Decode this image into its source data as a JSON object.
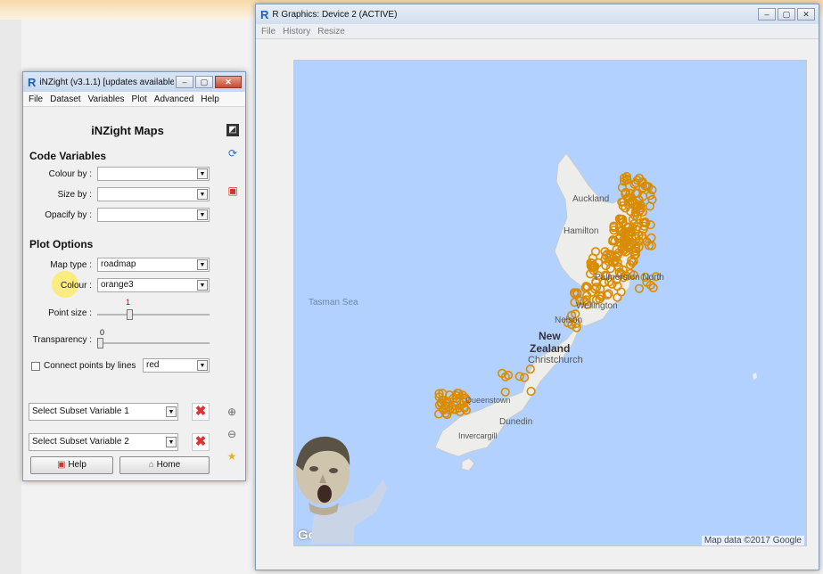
{
  "inzight": {
    "title": "iNZight (v3.1.1) [updates available]",
    "menu": [
      "File",
      "Dataset",
      "Variables",
      "Plot",
      "Advanced",
      "Help"
    ],
    "heading": "iNZight Maps",
    "code_variables": {
      "title": "Code Variables",
      "colour_by_label": "Colour by :",
      "size_by_label": "Size by :",
      "opacify_by_label": "Opacify by :",
      "colour_by_value": "",
      "size_by_value": "",
      "opacify_by_value": ""
    },
    "plot_options": {
      "title": "Plot Options",
      "map_type_label": "Map type :",
      "map_type_value": "roadmap",
      "colour_label": "Colour :",
      "colour_value": "orange3",
      "point_size_label": "Point size :",
      "point_size_value": "1",
      "point_size_level": 0.28,
      "transparency_label": "Transparency :",
      "transparency_value": "0",
      "transparency_level": 0.0,
      "connect_label": "Connect points by lines",
      "connect_checked": false,
      "line_colour": "red"
    },
    "subset1": "Select Subset Variable 1",
    "subset2": "Select Subset Variable 2",
    "help_button": "Help",
    "home_button": "Home"
  },
  "rgraphics": {
    "title": "R Graphics: Device 2 (ACTIVE)",
    "menu": [
      "File",
      "History",
      "Resize"
    ],
    "map_labels": {
      "tasman": "Tasman Sea",
      "auckland": "Auckland",
      "hamilton": "Hamilton",
      "palmerston": "Palmerston North",
      "wellington": "Wellington",
      "nelson": "Nelson",
      "new": "New",
      "zealand": "Zealand",
      "christchurch": "Christchurch",
      "queenstown": "Queenstown",
      "dunedin": "Dunedin",
      "invercargill": "Invercargill"
    },
    "google": "Google",
    "attribution": "Map data ©2017 Google"
  },
  "colors": {
    "point": "#d98c00",
    "water": "#b3d1ff",
    "land": "#ededeb",
    "accent": "#1f5fb0"
  }
}
